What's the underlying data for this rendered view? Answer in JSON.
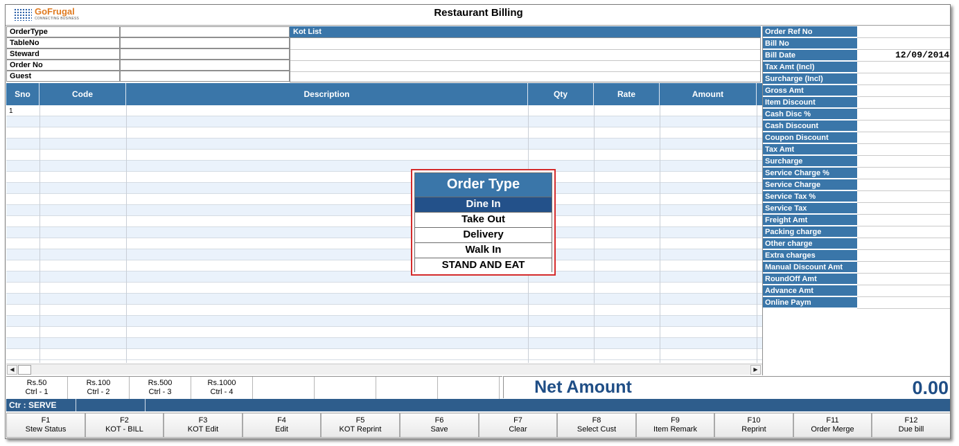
{
  "app": {
    "logo_name": "GoFrugal",
    "logo_tagline": "CONNECTING BUSINESS",
    "title": "Restaurant Billing"
  },
  "header": {
    "fields": [
      {
        "label": "OrderType",
        "value": ""
      },
      {
        "label": "TableNo",
        "value": ""
      },
      {
        "label": "Steward",
        "value": ""
      },
      {
        "label": "Order No",
        "value": ""
      },
      {
        "label": "Guest",
        "value": ""
      }
    ],
    "kot_list_label": "Kot List"
  },
  "grid": {
    "columns": [
      "Sno",
      "Code",
      "Description",
      "Qty",
      "Rate",
      "Amount"
    ],
    "rows": [
      {
        "sno": "1",
        "code": "",
        "description": "",
        "qty": "",
        "rate": "",
        "amount": ""
      }
    ]
  },
  "summary": {
    "fields": [
      {
        "label": "Order Ref No",
        "value": ""
      },
      {
        "label": "Bill No",
        "value": ""
      },
      {
        "label": "Bill Date",
        "value": "12/09/2014"
      },
      {
        "label": "Tax Amt (Incl)",
        "value": ""
      },
      {
        "label": "Surcharge (Incl)",
        "value": ""
      },
      {
        "label": "Gross Amt",
        "value": ""
      },
      {
        "label": "Item Discount",
        "value": ""
      },
      {
        "label": "Cash Disc %",
        "value": ""
      },
      {
        "label": "Cash Discount",
        "value": ""
      },
      {
        "label": "Coupon Discount",
        "value": ""
      },
      {
        "label": "Tax Amt",
        "value": ""
      },
      {
        "label": "Surcharge",
        "value": ""
      },
      {
        "label": "Service Charge %",
        "value": ""
      },
      {
        "label": "Service Charge",
        "value": ""
      },
      {
        "label": "Service Tax %",
        "value": ""
      },
      {
        "label": "Service Tax",
        "value": ""
      },
      {
        "label": "Freight Amt",
        "value": ""
      },
      {
        "label": "Packing charge",
        "value": ""
      },
      {
        "label": "Other charge",
        "value": ""
      },
      {
        "label": "Extra charges",
        "value": ""
      },
      {
        "label": "Manual Discount Amt",
        "value": ""
      },
      {
        "label": "RoundOff Amt",
        "value": ""
      },
      {
        "label": "Advance Amt",
        "value": ""
      },
      {
        "label": "Online Paym",
        "value": ""
      }
    ]
  },
  "denominations": [
    {
      "amount": "Rs.50",
      "shortcut": "Ctrl - 1"
    },
    {
      "amount": "Rs.100",
      "shortcut": "Ctrl - 2"
    },
    {
      "amount": "Rs.500",
      "shortcut": "Ctrl - 3"
    },
    {
      "amount": "Rs.1000",
      "shortcut": "Ctrl - 4"
    }
  ],
  "net_amount": {
    "label": "Net Amount",
    "value": "0.00"
  },
  "status_bar": {
    "counter": "Ctr : SERVE"
  },
  "function_keys": [
    {
      "key": "F1",
      "label": "Stew Status"
    },
    {
      "key": "F2",
      "label": "KOT - BILL"
    },
    {
      "key": "F3",
      "label": "KOT Edit"
    },
    {
      "key": "F4",
      "label": "Edit"
    },
    {
      "key": "F5",
      "label": "KOT Reprint"
    },
    {
      "key": "F6",
      "label": "Save"
    },
    {
      "key": "F7",
      "label": "Clear"
    },
    {
      "key": "F8",
      "label": "Select Cust"
    },
    {
      "key": "F9",
      "label": "Item Remark"
    },
    {
      "key": "F10",
      "label": "Reprint"
    },
    {
      "key": "F11",
      "label": "Order Merge"
    },
    {
      "key": "F12",
      "label": "Due bill"
    }
  ],
  "order_type_popup": {
    "title": "Order Type",
    "options": [
      "Dine In",
      "Take Out",
      "Delivery",
      "Walk In",
      "STAND AND EAT"
    ],
    "selected": "Dine In"
  },
  "colors": {
    "header_blue": "#3a76a9",
    "selected_option": "#23518a",
    "net_amount_text": "#1f4e86",
    "popup_border": "#d42a2a"
  }
}
